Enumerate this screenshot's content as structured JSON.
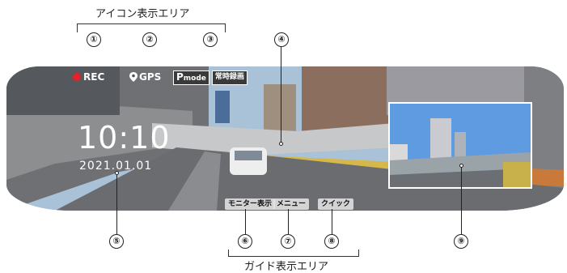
{
  "labels": {
    "icon_area": "アイコン表示エリア",
    "guide_area": "ガイド表示エリア"
  },
  "callouts": [
    "①",
    "②",
    "③",
    "④",
    "⑤",
    "⑥",
    "⑦",
    "⑧",
    "⑨"
  ],
  "hud": {
    "rec": "REC",
    "gps": "GPS",
    "pmode_letter": "P",
    "pmode_text": "mode",
    "record_mode": "常時録画",
    "time": "10:10",
    "date": "2021.01.01"
  },
  "guide_buttons": {
    "monitor": "モニター表示",
    "menu": "メニュー",
    "quick": "クイック"
  },
  "colors": {
    "rec_red": "#e8202a",
    "hud_text": "#ffffff"
  }
}
